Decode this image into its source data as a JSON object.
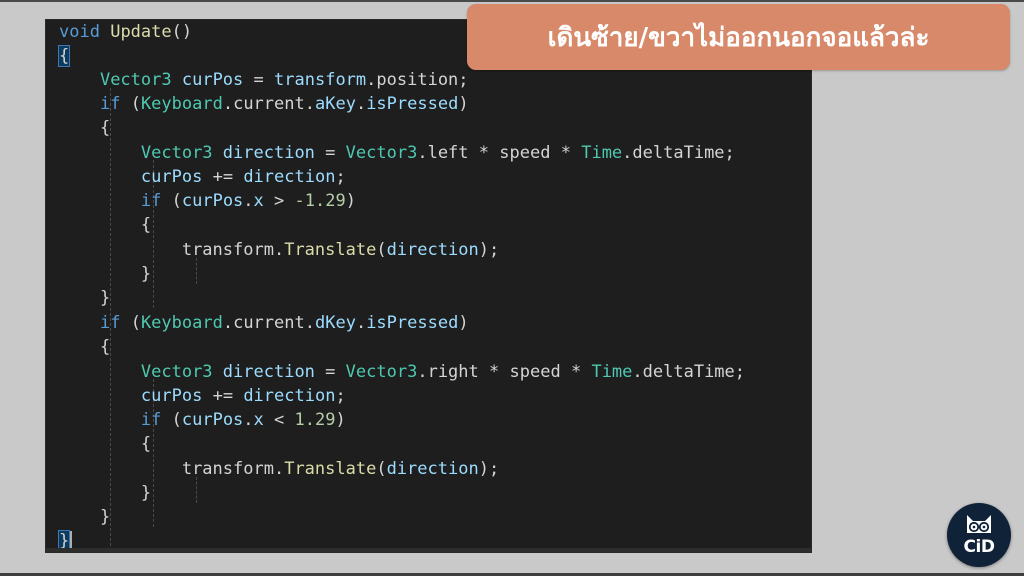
{
  "banner": {
    "text": "เดินซ้าย/ขวาไม่ออกนอกจอแล้วล่ะ"
  },
  "code": {
    "language": "csharp",
    "lines": [
      "void Update()",
      "{",
      "    Vector3 curPos = transform.position;",
      "    if (Keyboard.current.aKey.isPressed)",
      "    {",
      "        Vector3 direction = Vector3.left * speed * Time.deltaTime;",
      "        curPos += direction;",
      "        if (curPos.x > -1.29)",
      "        {",
      "            transform.Translate(direction);",
      "        }",
      "    }",
      "    if (Keyboard.current.dKey.isPressed)",
      "    {",
      "        Vector3 direction = Vector3.right * speed * Time.deltaTime;",
      "        curPos += direction;",
      "        if (curPos.x < 1.29)",
      "        {",
      "            transform.Translate(direction);",
      "        }",
      "    }",
      "}"
    ]
  },
  "logo": {
    "text": "CiD",
    "icon": "cat-with-glasses-icon"
  },
  "colors": {
    "background": "#c9c9c9",
    "editor_background": "#1e1e1e",
    "banner": "#d8896a",
    "keyword": "#569cd6",
    "type": "#4ec9b0",
    "function": "#dcdcaa",
    "variable": "#9cdcfe",
    "number": "#b5cea8",
    "logo_background": "#0f2238"
  }
}
